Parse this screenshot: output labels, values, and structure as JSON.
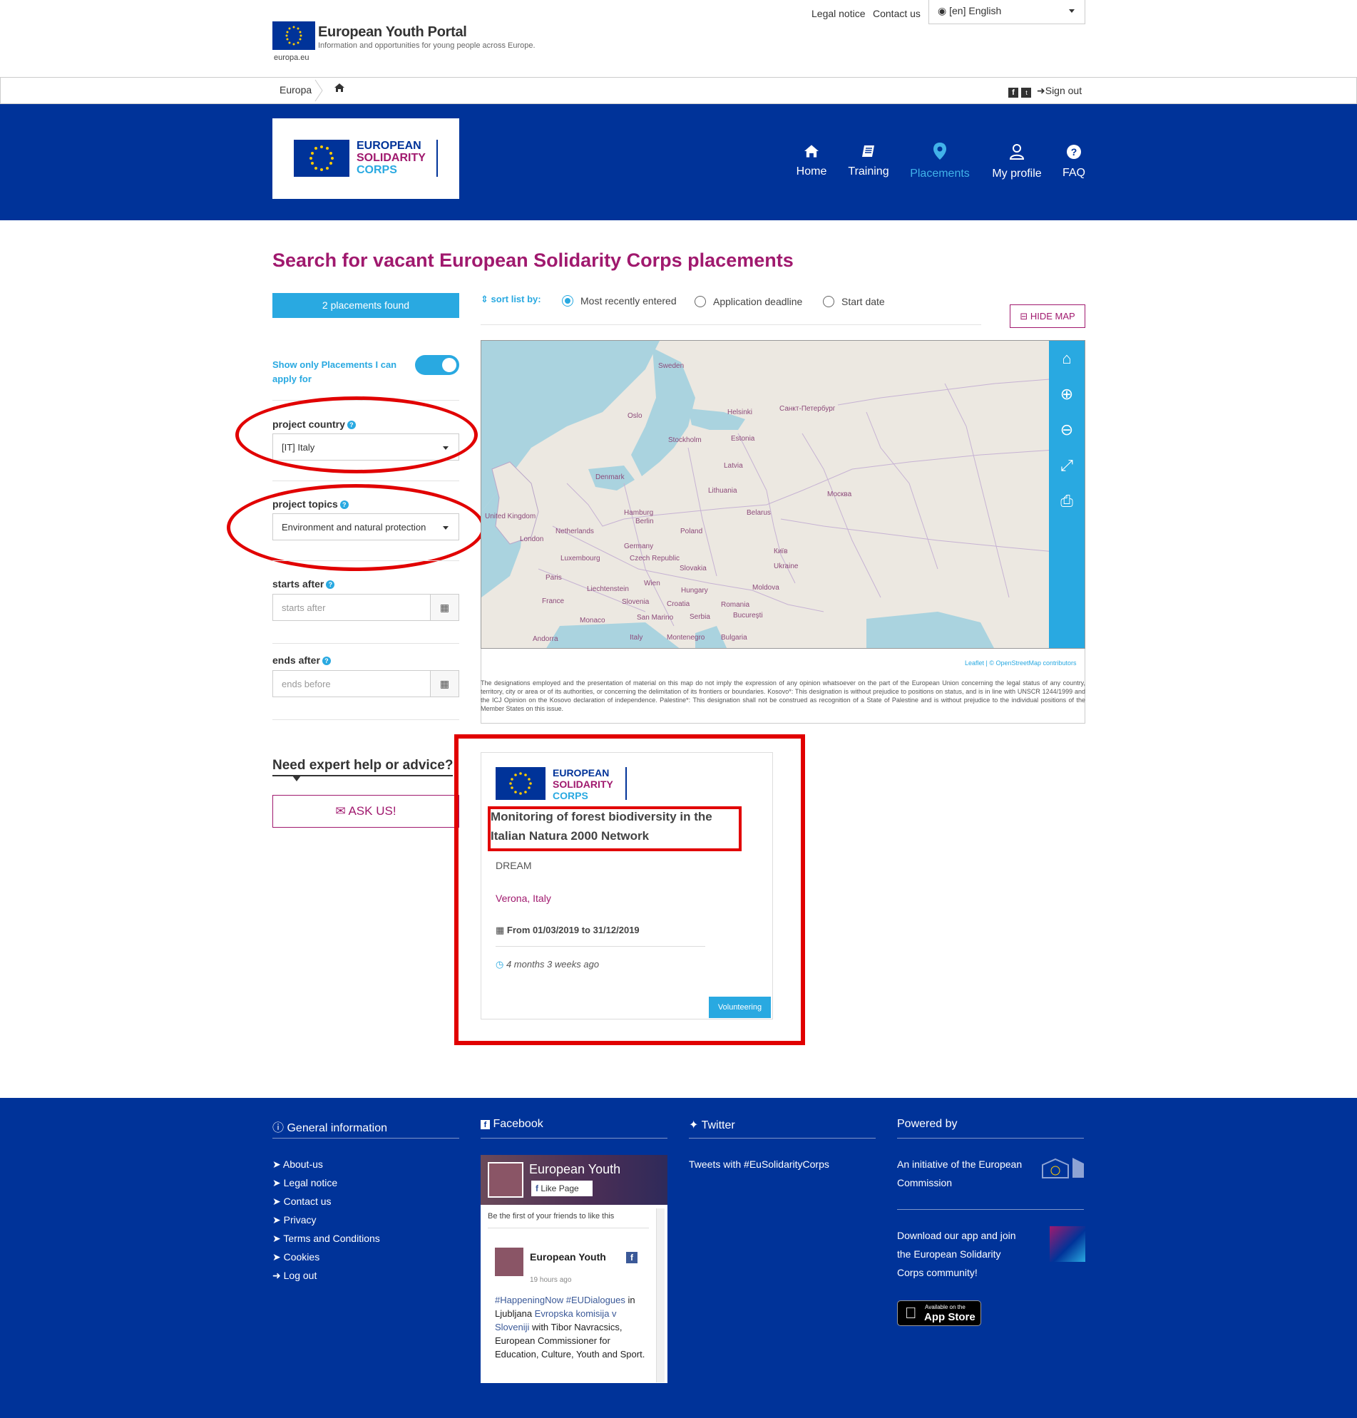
{
  "header": {
    "portal_title": "European Youth Portal",
    "portal_subtitle": "Information and opportunities for young people across Europe.",
    "europa_label": "europa.eu",
    "legal_notice": "Legal notice",
    "contact_us": "Contact us",
    "language": "[en] English"
  },
  "breadcrumb": {
    "europa": "Europa",
    "sign_out": "Sign out"
  },
  "brand": {
    "line1": "EUROPEAN",
    "line2": "SOLIDARITY",
    "line3": "CORPS"
  },
  "nav": {
    "home": "Home",
    "training": "Training",
    "placements": "Placements",
    "my_profile": "My profile",
    "faq": "FAQ"
  },
  "page_title": "Search for vacant European Solidarity Corps placements",
  "results": {
    "found_label": "2 placements found"
  },
  "sort": {
    "label": "sort list by:",
    "options": [
      "Most recently entered",
      "Application deadline",
      "Start date"
    ],
    "selected": "Most recently entered"
  },
  "hide_map": "HIDE MAP",
  "filters": {
    "toggle_label": "Show only Placements I can apply for",
    "toggle_on": true,
    "project_country_label": "project country",
    "project_country_value": "[IT] Italy",
    "project_topics_label": "project topics",
    "project_topics_value": "Environment and natural protection",
    "starts_after_label": "starts after",
    "starts_after_placeholder": "starts after",
    "ends_after_label": "ends after",
    "ends_after_placeholder": "ends before"
  },
  "map": {
    "labels": [
      "Sweden",
      "Oslo",
      "Helsinki",
      "Санкт-Петербург",
      "Stockholm",
      "Estonia",
      "Denmark",
      "Latvia",
      "Lithuania",
      "Москва",
      "United Kingdom",
      "Hamburg",
      "Belarus",
      "Netherlands",
      "Berlin",
      "Poland",
      "London",
      "Germany",
      "Київ",
      "Luxembourg",
      "Czech Republic",
      "Ukraine",
      "Slovakia",
      "Paris",
      "Liechtenstein",
      "Wien",
      "Moldova",
      "France",
      "Hungary",
      "Slovenia",
      "Croatia",
      "Romania",
      "Monaco",
      "San Marino",
      "Serbia",
      "Bucureşti",
      "Andorra",
      "Italy",
      "Montenegro",
      "Bulgaria"
    ],
    "attribution": "Leaflet | © OpenStreetMap contributors",
    "disclaimer": "The designations employed and the presentation of material on this map do not imply the expression of any opinion whatsoever on the part of the European Union concerning the legal status of any country, territory, city or area or of its authorities, or concerning the delimitation of its frontiers or boundaries. Kosovo*: This designation is without prejudice to positions on status, and is in line with UNSCR 1244/1999 and the ICJ Opinion on the Kosovo declaration of independence. Palestine*: This designation shall not be construed as recognition of a State of Palestine and is without prejudice to the individual positions of the Member States on this issue."
  },
  "help": {
    "title": "Need expert help or advice?",
    "ask_us": "ASK US!"
  },
  "card": {
    "title": "Monitoring of forest biodiversity in the Italian Natura 2000 Network",
    "organisation": "DREAM",
    "location": "Verona, Italy",
    "dates": "From 01/03/2019 to 31/12/2019",
    "posted": "4 months 3 weeks ago",
    "tag": "Volunteering"
  },
  "footer": {
    "general_title": "General information",
    "links": [
      "About-us",
      "Legal notice",
      "Contact us",
      "Privacy",
      "Terms and Conditions",
      "Cookies",
      "Log out"
    ],
    "facebook_title": "Facebook",
    "twitter_title": "Twitter",
    "twitter_text": "Tweets with #EuSolidarityCorps",
    "powered_title": "Powered by",
    "powered_text": "An initiative of the European Commission",
    "app_text": "Download our app and join the European Solidarity Corps community!",
    "app_store_small": "Available on the",
    "app_store_big": "App Store",
    "fb": {
      "page_name": "European Youth",
      "like_page": "Like Page",
      "friends_text": "Be the first of your friends to like this",
      "post_author": "European Youth",
      "post_time": "19 hours ago",
      "post_tags": "#HappeningNow #EUDialogues",
      "post_text_1": "in Ljubljana",
      "post_link": "Evropska komisija v Sloveniji",
      "post_text_2": "with Tibor Navracsics, European Commissioner for Education, Culture, Youth and Sport."
    }
  },
  "colors": {
    "brand_blue": "#003399",
    "accent_cyan": "#29a9e1",
    "magenta": "#a0196e",
    "highlight_red": "#e10000"
  }
}
